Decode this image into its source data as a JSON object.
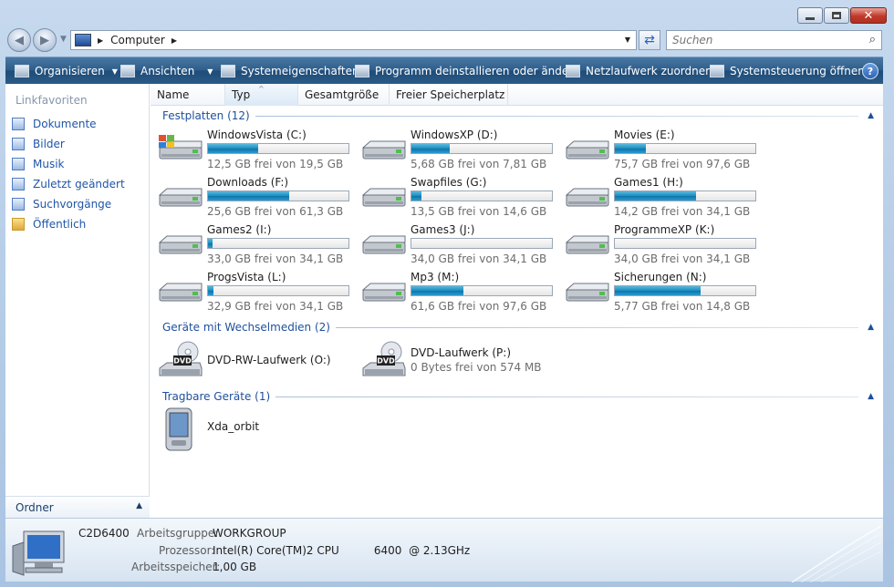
{
  "address": {
    "location": "Computer"
  },
  "search": {
    "placeholder": "Suchen"
  },
  "toolbar": {
    "organize": "Organisieren",
    "views": "Ansichten",
    "system_properties": "Systemeigenschaften",
    "uninstall": "Programm deinstallieren oder ändern",
    "map_drive": "Netzlaufwerk zuordnen",
    "control_panel": "Systemsteuerung öffnen",
    "help": "?"
  },
  "nav": {
    "heading": "Linkfavoriten",
    "items": [
      {
        "label": "Dokumente",
        "icon": "documents-icon"
      },
      {
        "label": "Bilder",
        "icon": "pictures-icon"
      },
      {
        "label": "Musik",
        "icon": "music-icon"
      },
      {
        "label": "Zuletzt geändert",
        "icon": "recent-icon"
      },
      {
        "label": "Suchvorgänge",
        "icon": "searches-icon"
      },
      {
        "label": "Öffentlich",
        "icon": "public-folder-icon"
      }
    ],
    "folders_label": "Ordner"
  },
  "columns": {
    "name": "Name",
    "type": "Typ",
    "total": "Gesamtgröße",
    "free": "Freier Speicherplatz"
  },
  "groups": {
    "hdd": "Festplatten (12)",
    "removable": "Geräte mit Wechselmedien (2)",
    "portable": "Tragbare Geräte (1)"
  },
  "drives": [
    {
      "name": "WindowsVista (C:)",
      "free": "12,5 GB frei von 19,5 GB",
      "used_fraction": 0.36,
      "os": true
    },
    {
      "name": "WindowsXP (D:)",
      "free": "5,68 GB frei von 7,81 GB",
      "used_fraction": 0.27
    },
    {
      "name": "Movies (E:)",
      "free": "75,7 GB frei von 97,6 GB",
      "used_fraction": 0.22
    },
    {
      "name": "Downloads (F:)",
      "free": "25,6 GB frei von 61,3 GB",
      "used_fraction": 0.58
    },
    {
      "name": "Swapfiles (G:)",
      "free": "13,5 GB frei von 14,6 GB",
      "used_fraction": 0.07
    },
    {
      "name": "Games1 (H:)",
      "free": "14,2 GB frei von 34,1 GB",
      "used_fraction": 0.58
    },
    {
      "name": "Games2 (I:)",
      "free": "33,0 GB frei von 34,1 GB",
      "used_fraction": 0.03
    },
    {
      "name": "Games3 (J:)",
      "free": "34,0 GB frei von 34,1 GB",
      "used_fraction": 0.0
    },
    {
      "name": "ProgrammeXP (K:)",
      "free": "34,0 GB frei von 34,1 GB",
      "used_fraction": 0.0
    },
    {
      "name": "ProgsVista (L:)",
      "free": "32,9 GB frei von 34,1 GB",
      "used_fraction": 0.04
    },
    {
      "name": "Mp3 (M:)",
      "free": "61,6 GB frei von 97,6 GB",
      "used_fraction": 0.37
    },
    {
      "name": "Sicherungen (N:)",
      "free": "5,77 GB frei von 14,8 GB",
      "used_fraction": 0.61
    }
  ],
  "removable": [
    {
      "name": "DVD-RW-Laufwerk (O:)",
      "free": ""
    },
    {
      "name": "DVD-Laufwerk (P:)",
      "free": "0 Bytes frei von 574 MB"
    }
  ],
  "dvd_label": "DVD",
  "portable": [
    {
      "name": "Xda_orbit"
    }
  ],
  "details": {
    "computer_name": "C2D6400",
    "workgroup_label": "Arbeitsgruppe:",
    "workgroup": "WORKGROUP",
    "cpu_label": "Prozessor:",
    "cpu": "Intel(R) Core(TM)2 CPU          6400  @ 2.13GHz",
    "ram_label": "Arbeitsspeicher:",
    "ram": "1,00 GB"
  }
}
